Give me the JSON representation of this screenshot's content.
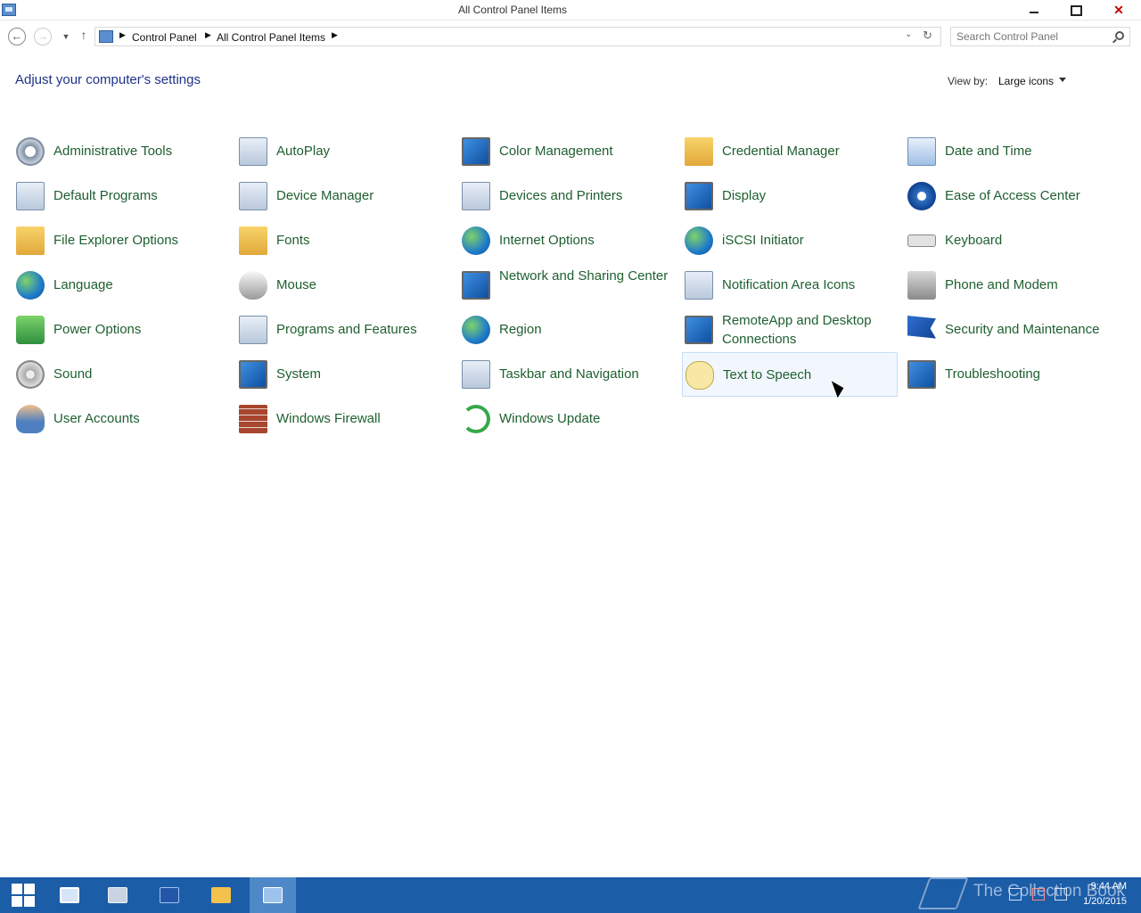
{
  "window": {
    "title": "All Control Panel Items"
  },
  "nav": {
    "breadcrumb": [
      "Control Panel",
      "All Control Panel Items"
    ],
    "search_placeholder": "Search Control Panel"
  },
  "header": {
    "title": "Adjust your computer's settings",
    "view_by_label": "View by:",
    "view_by_value": "Large icons"
  },
  "items": [
    {
      "label": "Administrative Tools",
      "icon": "administrative-tools-icon"
    },
    {
      "label": "AutoPlay",
      "icon": "autoplay-icon"
    },
    {
      "label": "Color Management",
      "icon": "color-management-icon"
    },
    {
      "label": "Credential Manager",
      "icon": "credential-manager-icon"
    },
    {
      "label": "Date and Time",
      "icon": "date-time-icon"
    },
    {
      "label": "Default Programs",
      "icon": "default-programs-icon"
    },
    {
      "label": "Device Manager",
      "icon": "device-manager-icon"
    },
    {
      "label": "Devices and Printers",
      "icon": "devices-printers-icon"
    },
    {
      "label": "Display",
      "icon": "display-icon"
    },
    {
      "label": "Ease of Access Center",
      "icon": "ease-of-access-icon"
    },
    {
      "label": "File Explorer Options",
      "icon": "file-explorer-options-icon"
    },
    {
      "label": "Fonts",
      "icon": "fonts-icon"
    },
    {
      "label": "Internet Options",
      "icon": "internet-options-icon"
    },
    {
      "label": "iSCSI Initiator",
      "icon": "iscsi-initiator-icon"
    },
    {
      "label": "Keyboard",
      "icon": "keyboard-icon"
    },
    {
      "label": "Language",
      "icon": "language-icon"
    },
    {
      "label": "Mouse",
      "icon": "mouse-icon"
    },
    {
      "label": "Network and Sharing Center",
      "icon": "network-sharing-icon"
    },
    {
      "label": "Notification Area Icons",
      "icon": "notification-area-icon"
    },
    {
      "label": "Phone and Modem",
      "icon": "phone-modem-icon"
    },
    {
      "label": "Power Options",
      "icon": "power-options-icon"
    },
    {
      "label": "Programs and Features",
      "icon": "programs-features-icon"
    },
    {
      "label": "Region",
      "icon": "region-icon"
    },
    {
      "label": "RemoteApp and Desktop Connections",
      "icon": "remoteapp-icon"
    },
    {
      "label": "Security and Maintenance",
      "icon": "security-maintenance-icon"
    },
    {
      "label": "Sound",
      "icon": "sound-icon"
    },
    {
      "label": "System",
      "icon": "system-icon"
    },
    {
      "label": "Taskbar and Navigation",
      "icon": "taskbar-navigation-icon"
    },
    {
      "label": "Text to Speech",
      "icon": "text-to-speech-icon"
    },
    {
      "label": "Troubleshooting",
      "icon": "troubleshooting-icon"
    },
    {
      "label": "User Accounts",
      "icon": "user-accounts-icon"
    },
    {
      "label": "Windows Firewall",
      "icon": "windows-firewall-icon"
    },
    {
      "label": "Windows Update",
      "icon": "windows-update-icon"
    }
  ],
  "taskbar": {
    "time": "9:44 AM",
    "date": "1/20/2015",
    "watermark": "The Collection Book",
    "accent": "#1c5da8"
  },
  "colors": {
    "link_green": "#1e5f2f",
    "heading_blue": "#1e3287",
    "hover_bg": "#f2f7fe"
  }
}
